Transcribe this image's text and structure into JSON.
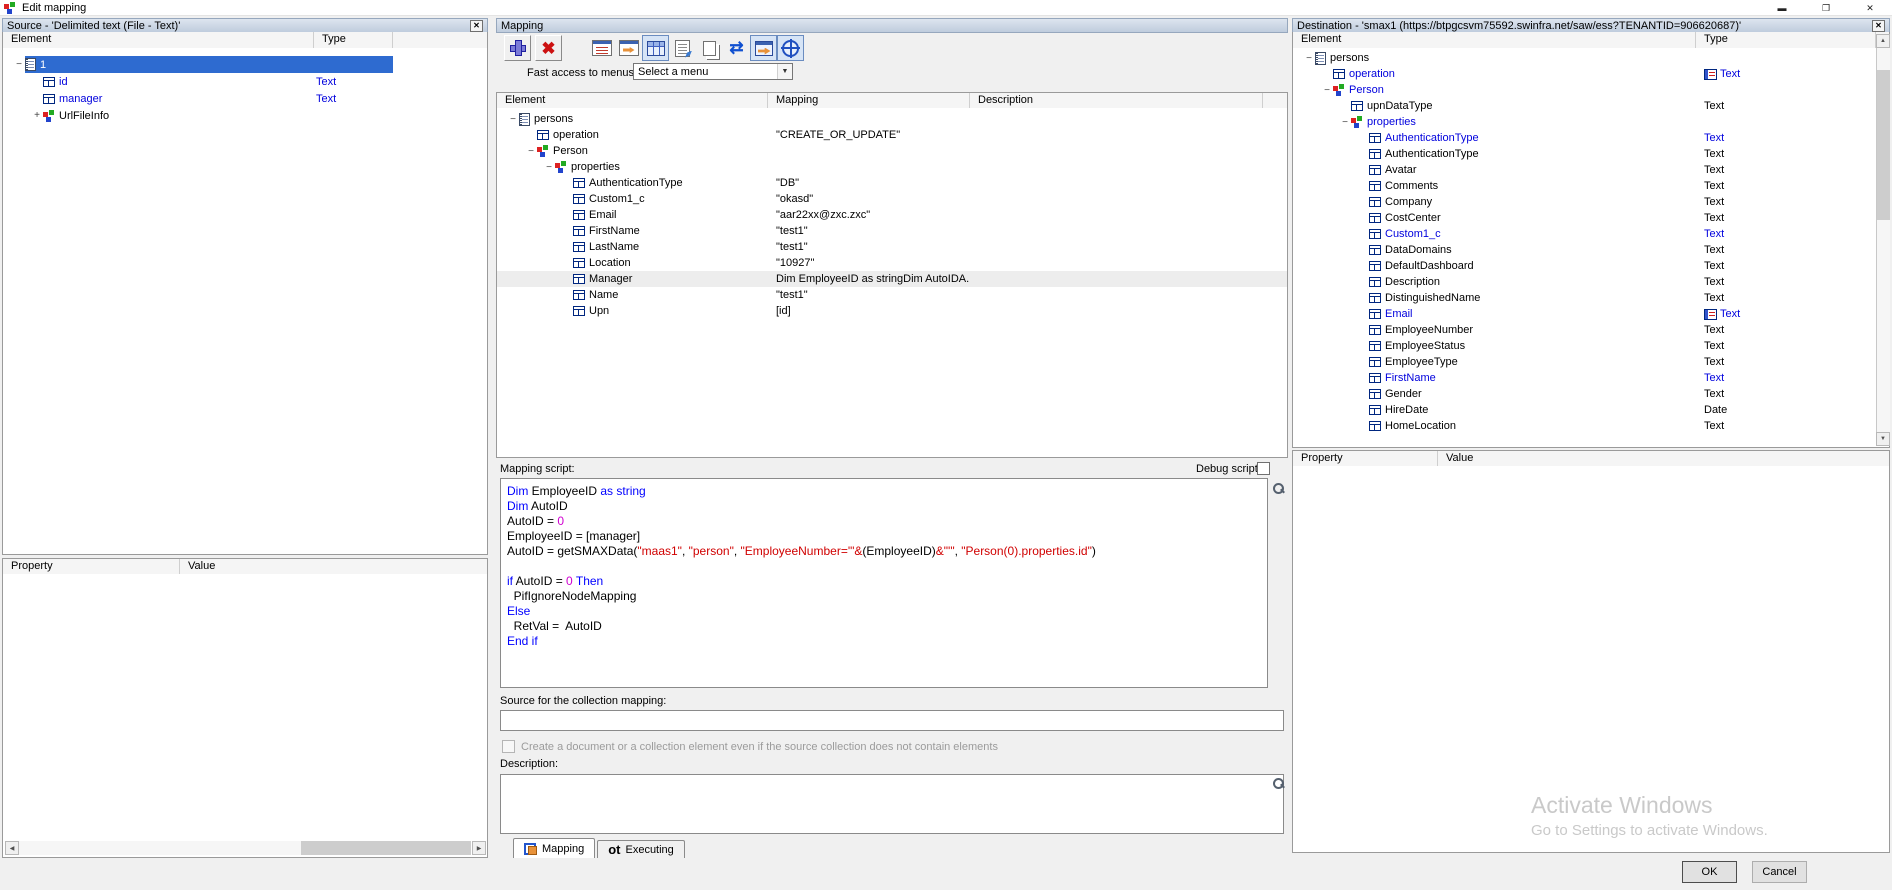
{
  "window": {
    "title": "Edit mapping",
    "controls": [
      "minimize",
      "restore",
      "close"
    ]
  },
  "source_panel": {
    "title": "Source - 'Delimited text (File - Text)'",
    "columns": [
      "Element",
      "Type"
    ],
    "rows": [
      {
        "label": "1",
        "type": "",
        "icon": "doc",
        "expander": "-",
        "level": 0,
        "selected": true,
        "color": "black"
      },
      {
        "label": "id",
        "type": "Text",
        "icon": "field",
        "expander": "",
        "level": 1,
        "color": "blue"
      },
      {
        "label": "manager",
        "type": "Text",
        "icon": "field",
        "expander": "",
        "level": 1,
        "color": "blue"
      },
      {
        "label": "UrlFileInfo",
        "type": "",
        "icon": "cubes",
        "expander": "+",
        "level": 1,
        "color": "black"
      }
    ],
    "property_columns": [
      "Property",
      "Value"
    ]
  },
  "mapping_panel": {
    "title": "Mapping",
    "toolbar": [
      {
        "name": "add-mapping",
        "icon": "plus",
        "style": "raised"
      },
      {
        "name": "delete-mapping",
        "icon": "redx",
        "style": "raised",
        "glyph": "✖"
      },
      {
        "name": "source-view",
        "icon": "win list",
        "style": "flat",
        "gap": true
      },
      {
        "name": "destination-view",
        "icon": "win move",
        "style": "flat"
      },
      {
        "name": "table-view",
        "icon": "table",
        "style": "pressed"
      },
      {
        "name": "script-view",
        "icon": "script",
        "style": "flat"
      },
      {
        "name": "copy",
        "icon": "copy",
        "style": "flat"
      },
      {
        "name": "swap-mapping",
        "icon": "swap",
        "style": "flat",
        "glyph": "⇄"
      },
      {
        "name": "export",
        "icon": "export",
        "style": "pressed"
      },
      {
        "name": "target",
        "icon": "target",
        "style": "pressed"
      }
    ],
    "fast_access_label": "Fast access to menus:",
    "fast_access_value": "Select a menu",
    "columns": [
      "Element",
      "Mapping",
      "Description"
    ],
    "rows": [
      {
        "label": "persons",
        "icon": "doc",
        "expander": "-",
        "level": 0,
        "mapping": ""
      },
      {
        "label": "operation",
        "icon": "field",
        "expander": "",
        "level": 1,
        "mapping": "\"CREATE_OR_UPDATE\""
      },
      {
        "label": "Person",
        "icon": "cubes",
        "expander": "-",
        "level": 1,
        "mapping": ""
      },
      {
        "label": "properties",
        "icon": "cubes",
        "expander": "-",
        "level": 2,
        "mapping": ""
      },
      {
        "label": "AuthenticationType",
        "icon": "field",
        "expander": "",
        "level": 3,
        "mapping": "\"DB\""
      },
      {
        "label": "Custom1_c",
        "icon": "field",
        "expander": "",
        "level": 3,
        "mapping": "\"okasd\""
      },
      {
        "label": "Email",
        "icon": "field",
        "expander": "",
        "level": 3,
        "mapping": "\"aar22xx@zxc.zxc\""
      },
      {
        "label": "FirstName",
        "icon": "field",
        "expander": "",
        "level": 3,
        "mapping": "\"test1\""
      },
      {
        "label": "LastName",
        "icon": "field",
        "expander": "",
        "level": 3,
        "mapping": "\"test1\""
      },
      {
        "label": "Location",
        "icon": "field",
        "expander": "",
        "level": 3,
        "mapping": "\"10927\""
      },
      {
        "label": "Manager",
        "icon": "field",
        "expander": "",
        "level": 3,
        "mapping": "Dim EmployeeID as stringDim AutoIDA...",
        "selected": true
      },
      {
        "label": "Name",
        "icon": "field",
        "expander": "",
        "level": 3,
        "mapping": "\"test1\""
      },
      {
        "label": "Upn",
        "icon": "field",
        "expander": "",
        "level": 3,
        "mapping": "[id]"
      }
    ],
    "script_label": "Mapping script:",
    "debug_label": "Debug script:",
    "script_lines": [
      [
        [
          "k",
          "Dim"
        ],
        [
          "p",
          " EmployeeID "
        ],
        [
          "k",
          "as string"
        ]
      ],
      [
        [
          "k",
          "Dim"
        ],
        [
          "p",
          " AutoID"
        ]
      ],
      [
        [
          "p",
          "AutoID = "
        ],
        [
          "n",
          "0"
        ]
      ],
      [
        [
          "p",
          "EmployeeID = [manager]"
        ]
      ],
      [
        [
          "p",
          "AutoID = getSMAXData("
        ],
        [
          "s",
          "\"maas1\""
        ],
        [
          "p",
          ", "
        ],
        [
          "s",
          "\"person\""
        ],
        [
          "p",
          ", "
        ],
        [
          "s",
          "\"EmployeeNumber='\""
        ],
        [
          "s",
          "&"
        ],
        [
          "p",
          "(EmployeeID)"
        ],
        [
          "s",
          "&"
        ],
        [
          "s",
          "\"'\""
        ],
        [
          "p",
          ", "
        ],
        [
          "s",
          "\"Person(0).properties.id\""
        ],
        [
          "p",
          ")"
        ]
      ],
      [],
      [
        [
          "k",
          "if"
        ],
        [
          "p",
          " AutoID = "
        ],
        [
          "n",
          "0"
        ],
        [
          "p",
          " "
        ],
        [
          "k",
          "Then"
        ]
      ],
      [
        [
          "p",
          "  PifIgnoreNodeMapping"
        ]
      ],
      [
        [
          "k",
          "Else"
        ]
      ],
      [
        [
          "p",
          "  RetVal =  AutoID"
        ]
      ],
      [
        [
          "k",
          "End if"
        ]
      ]
    ],
    "collection_source_label": "Source for the collection mapping:",
    "collection_source_value": "",
    "collection_checkbox_label": "Create a document or a collection element even if the source collection does not contain elements",
    "description_label": "Description:",
    "description_value": "",
    "tabs": [
      {
        "label": "Mapping",
        "icon": "maptab",
        "active": true
      },
      {
        "label": "Executing",
        "icon": "ot",
        "active": false,
        "icon_text": "ot"
      }
    ]
  },
  "destination_panel": {
    "title": "Destination - 'smax1 (https://btpgcsvm75592.swinfra.net/saw/ess?TENANTID=906620687)'",
    "columns": [
      "Element",
      "Type"
    ],
    "rows": [
      {
        "label": "persons",
        "icon": "doc",
        "expander": "-",
        "level": 0,
        "type": "",
        "color": "black",
        "type_icon": false
      },
      {
        "label": "operation",
        "icon": "field",
        "expander": "",
        "level": 1,
        "type": "Text",
        "color": "blue",
        "type_icon": true
      },
      {
        "label": "Person",
        "icon": "cubes",
        "expander": "-",
        "level": 1,
        "type": "",
        "color": "blue",
        "type_icon": false
      },
      {
        "label": "upnDataType",
        "icon": "field",
        "expander": "",
        "level": 2,
        "type": "Text",
        "color": "black",
        "type_icon": false
      },
      {
        "label": "properties",
        "icon": "cubes",
        "expander": "-",
        "level": 2,
        "type": "",
        "color": "blue",
        "type_icon": false
      },
      {
        "label": "AuthenticationType",
        "icon": "field",
        "expander": "",
        "level": 3,
        "type": "Text",
        "color": "blue",
        "type_icon": false
      },
      {
        "label": "AuthenticationType",
        "icon": "field",
        "expander": "",
        "level": 3,
        "type": "Text",
        "color": "black",
        "type_icon": false
      },
      {
        "label": "Avatar",
        "icon": "field",
        "expander": "",
        "level": 3,
        "type": "Text",
        "color": "black",
        "type_icon": false
      },
      {
        "label": "Comments",
        "icon": "field",
        "expander": "",
        "level": 3,
        "type": "Text",
        "color": "black",
        "type_icon": false
      },
      {
        "label": "Company",
        "icon": "field",
        "expander": "",
        "level": 3,
        "type": "Text",
        "color": "black",
        "type_icon": false
      },
      {
        "label": "CostCenter",
        "icon": "field",
        "expander": "",
        "level": 3,
        "type": "Text",
        "color": "black",
        "type_icon": false
      },
      {
        "label": "Custom1_c",
        "icon": "field",
        "expander": "",
        "level": 3,
        "type": "Text",
        "color": "blue",
        "type_icon": false
      },
      {
        "label": "DataDomains",
        "icon": "field",
        "expander": "",
        "level": 3,
        "type": "Text",
        "color": "black",
        "type_icon": false
      },
      {
        "label": "DefaultDashboard",
        "icon": "field",
        "expander": "",
        "level": 3,
        "type": "Text",
        "color": "black",
        "type_icon": false
      },
      {
        "label": "Description",
        "icon": "field",
        "expander": "",
        "level": 3,
        "type": "Text",
        "color": "black",
        "type_icon": false
      },
      {
        "label": "DistinguishedName",
        "icon": "field",
        "expander": "",
        "level": 3,
        "type": "Text",
        "color": "black",
        "type_icon": false
      },
      {
        "label": "Email",
        "icon": "field",
        "expander": "",
        "level": 3,
        "type": "Text",
        "color": "blue",
        "type_icon": true
      },
      {
        "label": "EmployeeNumber",
        "icon": "field",
        "expander": "",
        "level": 3,
        "type": "Text",
        "color": "black",
        "type_icon": false
      },
      {
        "label": "EmployeeStatus",
        "icon": "field",
        "expander": "",
        "level": 3,
        "type": "Text",
        "color": "black",
        "type_icon": false
      },
      {
        "label": "EmployeeType",
        "icon": "field",
        "expander": "",
        "level": 3,
        "type": "Text",
        "color": "black",
        "type_icon": false
      },
      {
        "label": "FirstName",
        "icon": "field",
        "expander": "",
        "level": 3,
        "type": "Text",
        "color": "blue",
        "type_icon": false
      },
      {
        "label": "Gender",
        "icon": "field",
        "expander": "",
        "level": 3,
        "type": "Text",
        "color": "black",
        "type_icon": false
      },
      {
        "label": "HireDate",
        "icon": "field",
        "expander": "",
        "level": 3,
        "type": "Date",
        "color": "black",
        "type_icon": false
      },
      {
        "label": "HomeLocation",
        "icon": "field",
        "expander": "",
        "level": 3,
        "type": "Text",
        "color": "black",
        "type_icon": false
      }
    ],
    "property_columns": [
      "Property",
      "Value"
    ]
  },
  "watermark": {
    "line1": "Activate Windows",
    "line2": "Go to Settings to activate Windows."
  },
  "footer": {
    "ok_label": "OK",
    "cancel_label": "Cancel"
  }
}
